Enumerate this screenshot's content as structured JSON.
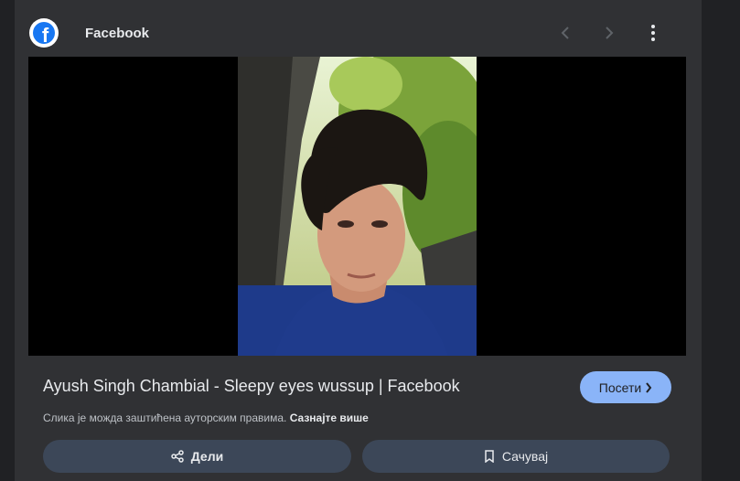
{
  "source": {
    "site_name": "Facebook",
    "logo_icon": "facebook-logo-icon"
  },
  "nav": {
    "prev_icon": "chevron-left-icon",
    "next_icon": "chevron-right-icon",
    "more_icon": "more-vert-icon"
  },
  "result": {
    "title": "Ayush Singh Chambial - Sleepy eyes wussup | Facebook",
    "visit_label": "Посети",
    "copyright_text": "Слика је можда заштићена ауторским правима.",
    "learn_more_label": "Сазнајте више"
  },
  "actions": {
    "share_label": "Дели",
    "save_label": "Сачувај"
  },
  "colors": {
    "background": "#202124",
    "panel": "#303134",
    "accent": "#8ab4f8",
    "action_button": "#3c4758"
  }
}
